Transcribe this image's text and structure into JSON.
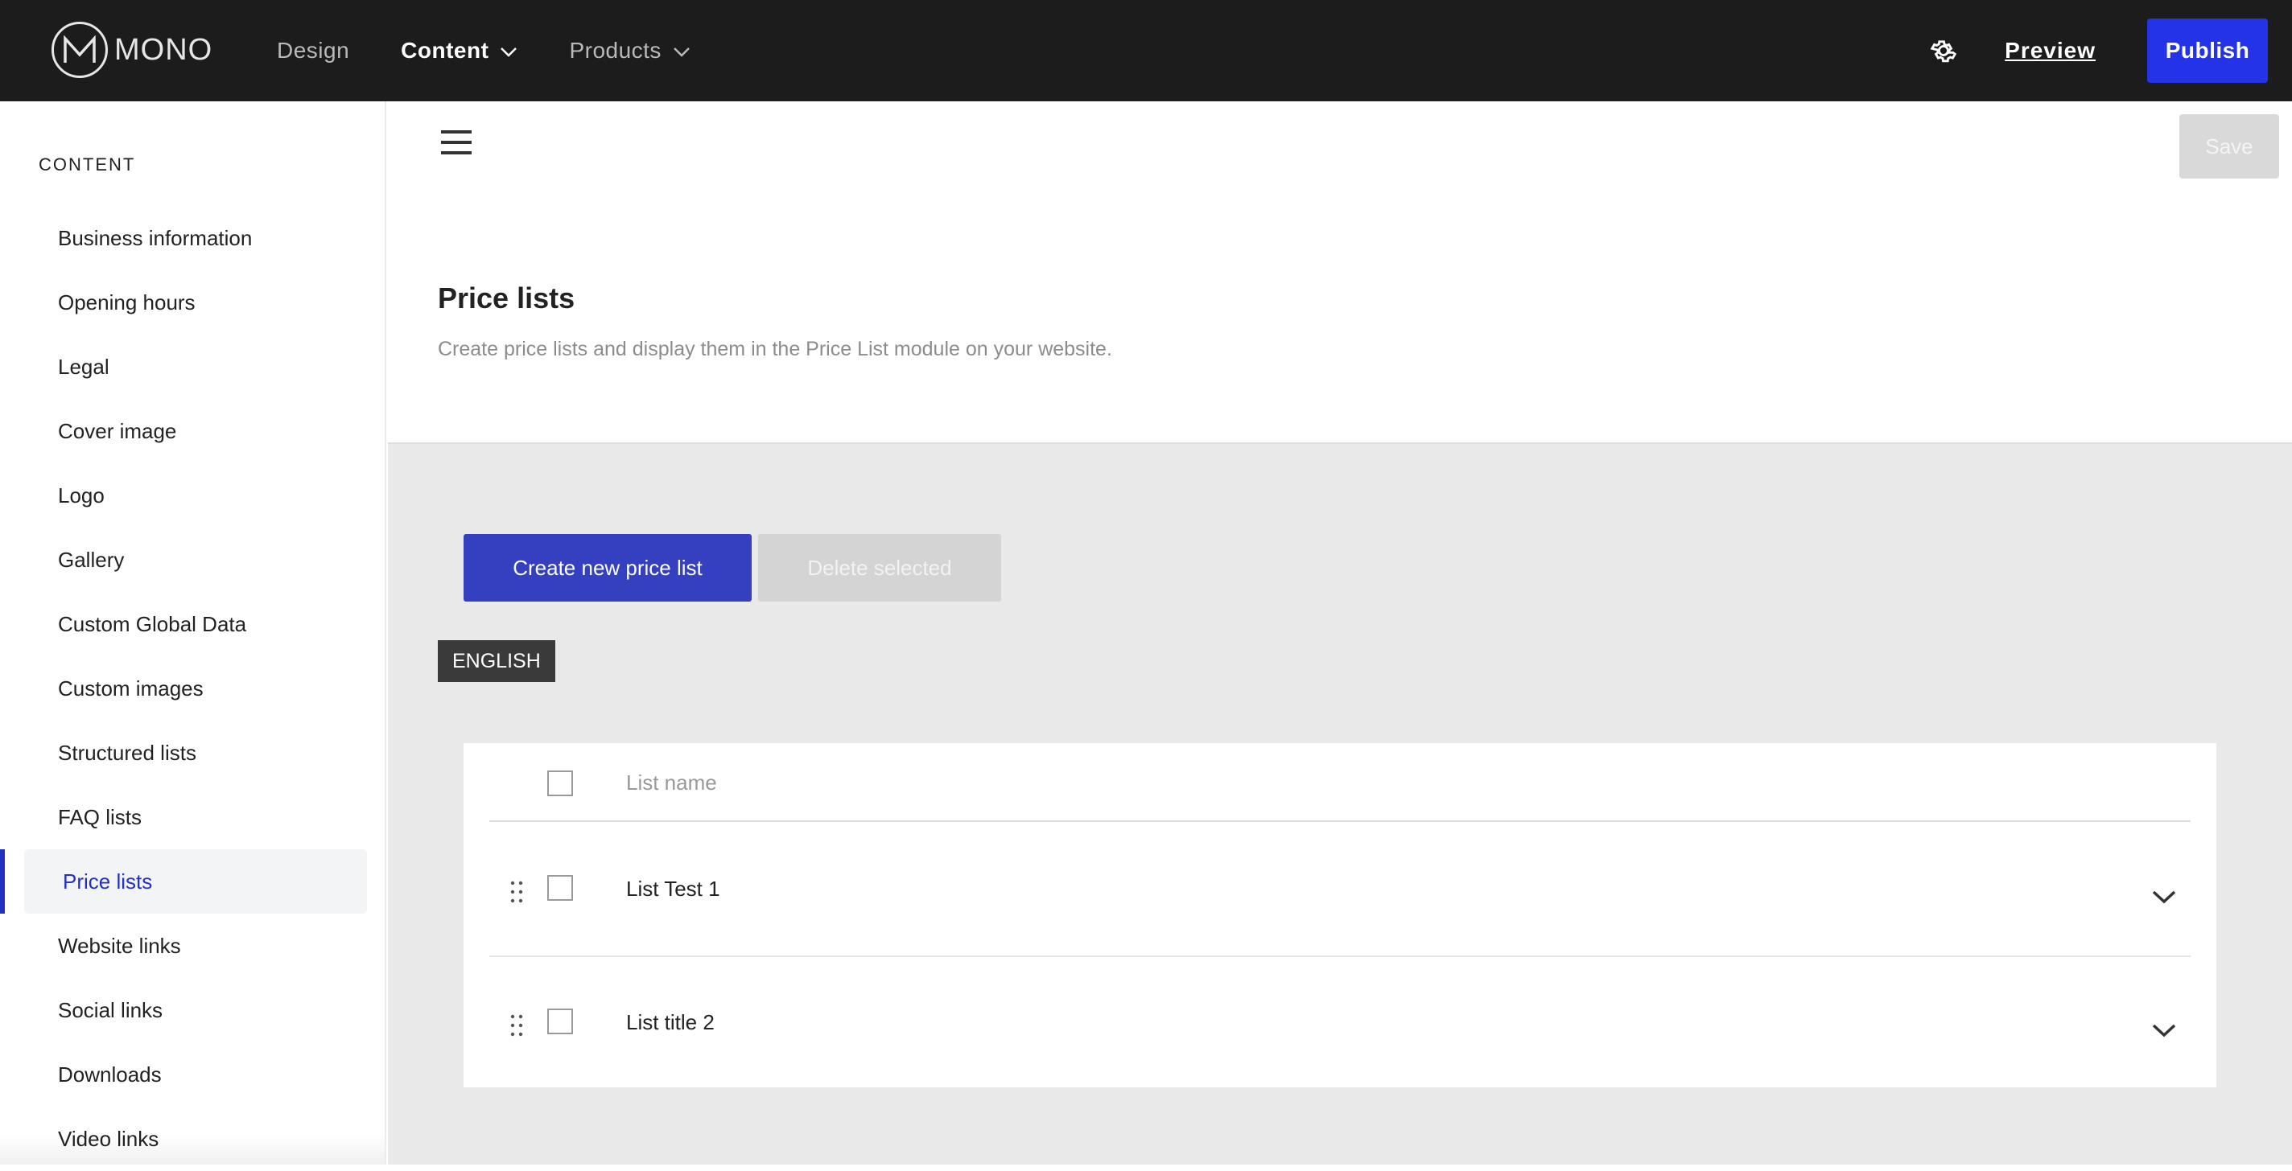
{
  "brand": {
    "name": "MONO"
  },
  "nav": {
    "items": [
      {
        "label": "Design",
        "active": false,
        "has_dropdown": false
      },
      {
        "label": "Content",
        "active": true,
        "has_dropdown": true
      },
      {
        "label": "Products",
        "active": false,
        "has_dropdown": true
      }
    ],
    "preview_label": "Preview",
    "publish_label": "Publish"
  },
  "sidebar": {
    "heading": "CONTENT",
    "items": [
      {
        "label": "Business information"
      },
      {
        "label": "Opening hours"
      },
      {
        "label": "Legal"
      },
      {
        "label": "Cover image"
      },
      {
        "label": "Logo"
      },
      {
        "label": "Gallery"
      },
      {
        "label": "Custom Global Data"
      },
      {
        "label": "Custom images"
      },
      {
        "label": "Structured lists"
      },
      {
        "label": "FAQ lists"
      },
      {
        "label": "Price lists",
        "active": true
      },
      {
        "label": "Website links"
      },
      {
        "label": "Social links"
      },
      {
        "label": "Downloads"
      },
      {
        "label": "Video links"
      }
    ]
  },
  "main": {
    "save_label": "Save",
    "title": "Price lists",
    "description": "Create price lists and display them in the Price List module on your website.",
    "create_label": "Create new price list",
    "delete_label": "Delete selected",
    "language": "ENGLISH",
    "table": {
      "column": "List name",
      "rows": [
        {
          "name": "List Test 1"
        },
        {
          "name": "List title 2"
        }
      ]
    }
  },
  "colors": {
    "topbar": "#1c1c1c",
    "publish": "#2432e8",
    "primary_button": "#3440c0",
    "active_nav": "#2330c4",
    "body_bg": "#e9e9e9"
  },
  "icons": [
    "logo-icon",
    "chevron-down-icon",
    "gear-icon",
    "hamburger-icon",
    "drag-handle-icon",
    "checkbox-icon",
    "chevron-down-icon"
  ]
}
